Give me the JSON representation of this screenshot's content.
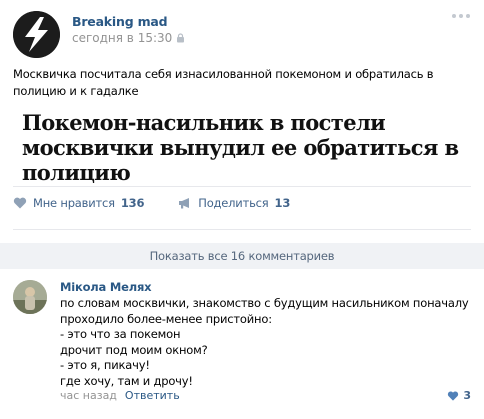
{
  "post": {
    "author": "Breaking mad",
    "time": "сегодня в 15:30",
    "text": "Москвичка посчитала себя изнасилованной покемоном и обратилась в полицию и к гадалке",
    "headline": "Покемон-насильник в постели москвички вынудил ее обратиться в полицию",
    "actions": {
      "like_label": "Мне нравится",
      "like_count": "136",
      "share_label": "Поделиться",
      "share_count": "13"
    }
  },
  "comments": {
    "show_all": "Показать все 16 комментариев",
    "items": [
      {
        "author": "Мікола Меляx",
        "lines": [
          "по словам москвички, знакомство с будущим насильником поначалу",
          "проходило более-менее пристойно:",
          "- это что за покемон",
          "дрочит под моим окном?",
          "- это я, пикачу!",
          "где хочу, там и дрочу!"
        ],
        "time": "час назад",
        "reply": "Ответить",
        "likes": "3"
      }
    ]
  },
  "colors": {
    "link": "#2a5885",
    "action": "#42648b",
    "muted": "#939393",
    "bar": "#f0f2f5"
  },
  "icons": [
    "lightning-logo-icon",
    "lock-icon",
    "more-dots-icon",
    "heart-icon",
    "megaphone-icon"
  ]
}
